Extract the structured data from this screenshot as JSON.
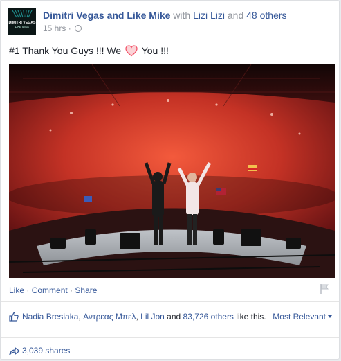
{
  "post": {
    "author": "Dimitri Vegas and Like Mike",
    "with_prefix": "with",
    "tagged": "Lizi Lizi",
    "and_word": "and",
    "others": "48 others",
    "timestamp": "15 hrs",
    "meta_sep": "·",
    "text_before": "#1 Thank You Guys !!! We",
    "text_after": "You !!!",
    "avatar_text_line1": "DIMITRI VEGAS",
    "avatar_text_line2": "LIKE MIKE"
  },
  "actions": {
    "like": "Like",
    "comment": "Comment",
    "share": "Share",
    "sep": "·"
  },
  "likes": {
    "names": [
      "Nadia Bresiaka",
      "Αντρεας Μπελ",
      "Lil Jon"
    ],
    "comma": ",",
    "and_word": "and",
    "others": "83,726 others",
    "like_suffix": "like this.",
    "sort_label": "Most Relevant"
  },
  "shares": {
    "label": "3,039 shares"
  },
  "colors": {
    "link": "#365899",
    "secondary": "#90949c",
    "heart": "#f25268"
  }
}
